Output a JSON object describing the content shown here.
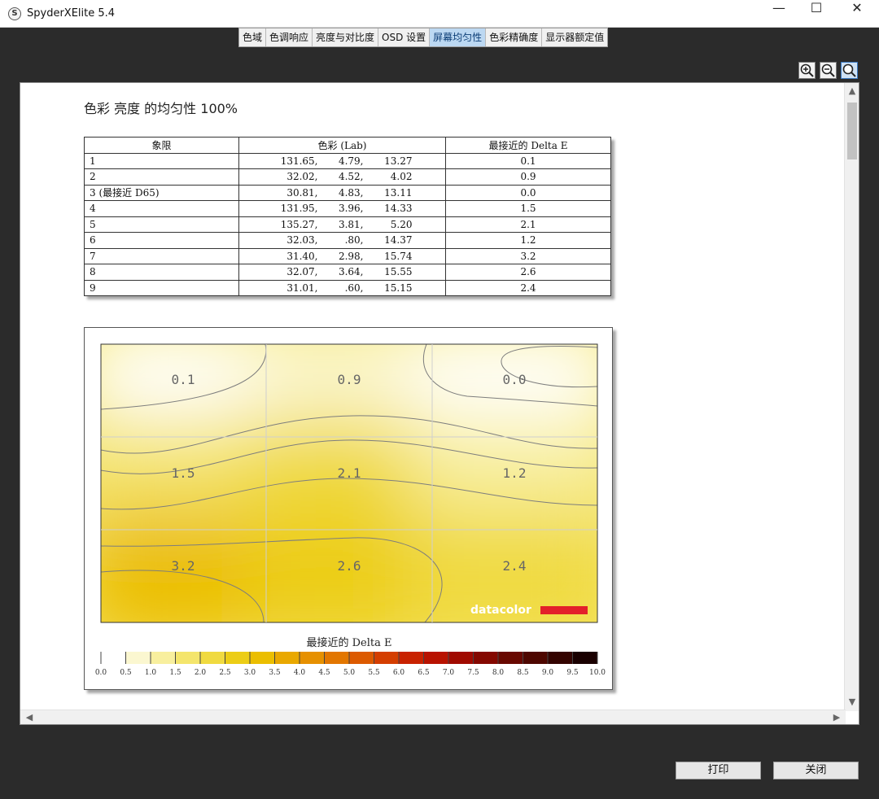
{
  "window": {
    "title": "SpyderXElite 5.4",
    "app_icon_letter": "S",
    "minimize": "—",
    "maximize": "☐",
    "close": "✕"
  },
  "tabs": [
    {
      "label": "色域",
      "active": false
    },
    {
      "label": "色调响应",
      "active": false
    },
    {
      "label": "亮度与对比度",
      "active": false
    },
    {
      "label": "OSD 设置",
      "active": false
    },
    {
      "label": "屏幕均匀性",
      "active": true
    },
    {
      "label": "色彩精确度",
      "active": false
    },
    {
      "label": "显示器额定值",
      "active": false
    }
  ],
  "zoom_icons": [
    "zoom-in-icon",
    "zoom-out-icon",
    "zoom-fit-icon"
  ],
  "report": {
    "title": "色彩 亮度 的均匀性 100%",
    "table": {
      "headers": [
        "象限",
        "色彩 (Lab)",
        "最接近的 Delta E"
      ],
      "rows": [
        {
          "quadrant": "1",
          "L": "131.65,",
          "a": "4.79,",
          "b": "13.27",
          "delta_e": "0.1"
        },
        {
          "quadrant": "2",
          "L": "32.02,",
          "a": "4.52,",
          "b": "4.02",
          "delta_e": "0.9"
        },
        {
          "quadrant": "3 (最接近 D65)",
          "L": "30.81,",
          "a": "4.83,",
          "b": "13.11",
          "delta_e": "0.0"
        },
        {
          "quadrant": "4",
          "L": "131.95,",
          "a": "3.96,",
          "b": "14.33",
          "delta_e": "1.5"
        },
        {
          "quadrant": "5",
          "L": "135.27,",
          "a": "3.81,",
          "b": "5.20",
          "delta_e": "2.1"
        },
        {
          "quadrant": "6",
          "L": "32.03,",
          "a": ".80,",
          "b": "14.37",
          "delta_e": "1.2"
        },
        {
          "quadrant": "7",
          "L": "31.40,",
          "a": "2.98,",
          "b": "15.74",
          "delta_e": "3.2"
        },
        {
          "quadrant": "8",
          "L": "32.07,",
          "a": "3.64,",
          "b": "15.55",
          "delta_e": "2.6"
        },
        {
          "quadrant": "9",
          "L": "31.01,",
          "a": ".60,",
          "b": "15.15",
          "delta_e": "2.4"
        }
      ]
    }
  },
  "chart_data": {
    "type": "heatmap",
    "title": "",
    "grid": "3x3",
    "cells": [
      [
        "0.1",
        "0.9",
        "0.0"
      ],
      [
        "1.5",
        "2.1",
        "1.2"
      ],
      [
        "3.2",
        "2.6",
        "2.4"
      ]
    ],
    "cell_values": [
      [
        0.1,
        0.9,
        0.0
      ],
      [
        1.5,
        2.1,
        1.2
      ],
      [
        3.2,
        2.6,
        2.4
      ]
    ],
    "colorbar": {
      "label": "最接近的 Delta E",
      "min": 0,
      "max": 10,
      "ticks": [
        "0.0",
        "0.5",
        "1.0",
        "1.5",
        "2.0",
        "2.5",
        "3.0",
        "3.5",
        "4.0",
        "4.5",
        "5.0",
        "5.5",
        "6.0",
        "6.5",
        "7.0",
        "7.5",
        "8.0",
        "8.5",
        "9.0",
        "9.5",
        "10.0"
      ],
      "colors": [
        "#ffffff",
        "#fbf7d0",
        "#f8ef9e",
        "#f4e56c",
        "#f0da40",
        "#eccd16",
        "#ebbe00",
        "#e9a800",
        "#e69000",
        "#e27600",
        "#dc5a00",
        "#d43e00",
        "#c82200",
        "#b81200",
        "#a00a00",
        "#840800",
        "#680800",
        "#4e0700",
        "#340400",
        "#1a0000"
      ]
    },
    "watermark": "datacolor",
    "colors": {
      "brand_red": "#e3202a"
    }
  },
  "buttons": {
    "print": "打印",
    "close": "关闭"
  }
}
